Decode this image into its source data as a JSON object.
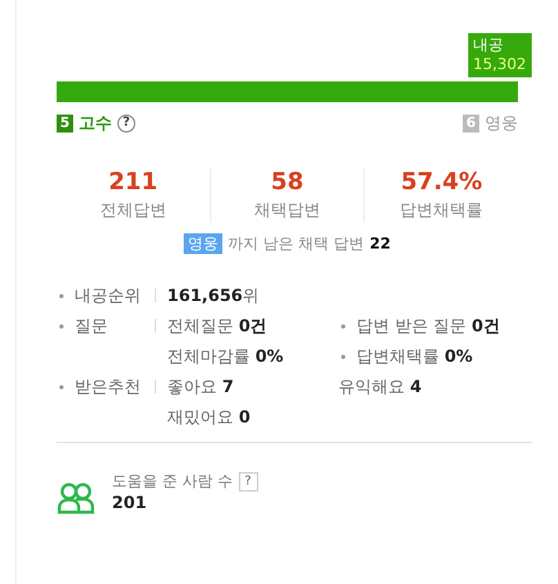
{
  "progress": {
    "tooltip_label": "내공",
    "tooltip_value": "15,302",
    "level": 1
  },
  "grade": {
    "current_number": "5",
    "current_name": "고수",
    "help": "?",
    "next_number": "6",
    "next_name": "영웅"
  },
  "stats": [
    {
      "value": "211",
      "label": "전체답변"
    },
    {
      "value": "58",
      "label": "채택답변"
    },
    {
      "value": "57.4%",
      "label": "답변채택률"
    }
  ],
  "remaining": {
    "badge": "영웅",
    "text": "까지 남은 채택 답변",
    "count": "22"
  },
  "info_rows": [
    {
      "label": "내공순위",
      "lines": [
        [
          {
            "text": "**161,656**위",
            "bullet": false
          }
        ]
      ]
    },
    {
      "label": "질문",
      "lines": [
        [
          {
            "text": "전체질문 **0건**",
            "bullet": false
          },
          {
            "text": "답변 받은 질문 **0건**",
            "bullet": true
          }
        ],
        [
          {
            "text": "전체마감률 **0%**",
            "bullet": false
          },
          {
            "text": "답변채택률 **0%**",
            "bullet": true
          }
        ]
      ]
    },
    {
      "label": "받은추천",
      "lines": [
        [
          {
            "text": "좋아요 **7**",
            "bullet": false
          },
          {
            "text": "유익해요 **4**",
            "bullet": false
          }
        ],
        [
          {
            "text": "재밌어요 **0**",
            "bullet": false
          }
        ]
      ]
    }
  ],
  "helpers": {
    "label": "도움을 준 사람 수",
    "help": "?",
    "count": "201"
  }
}
